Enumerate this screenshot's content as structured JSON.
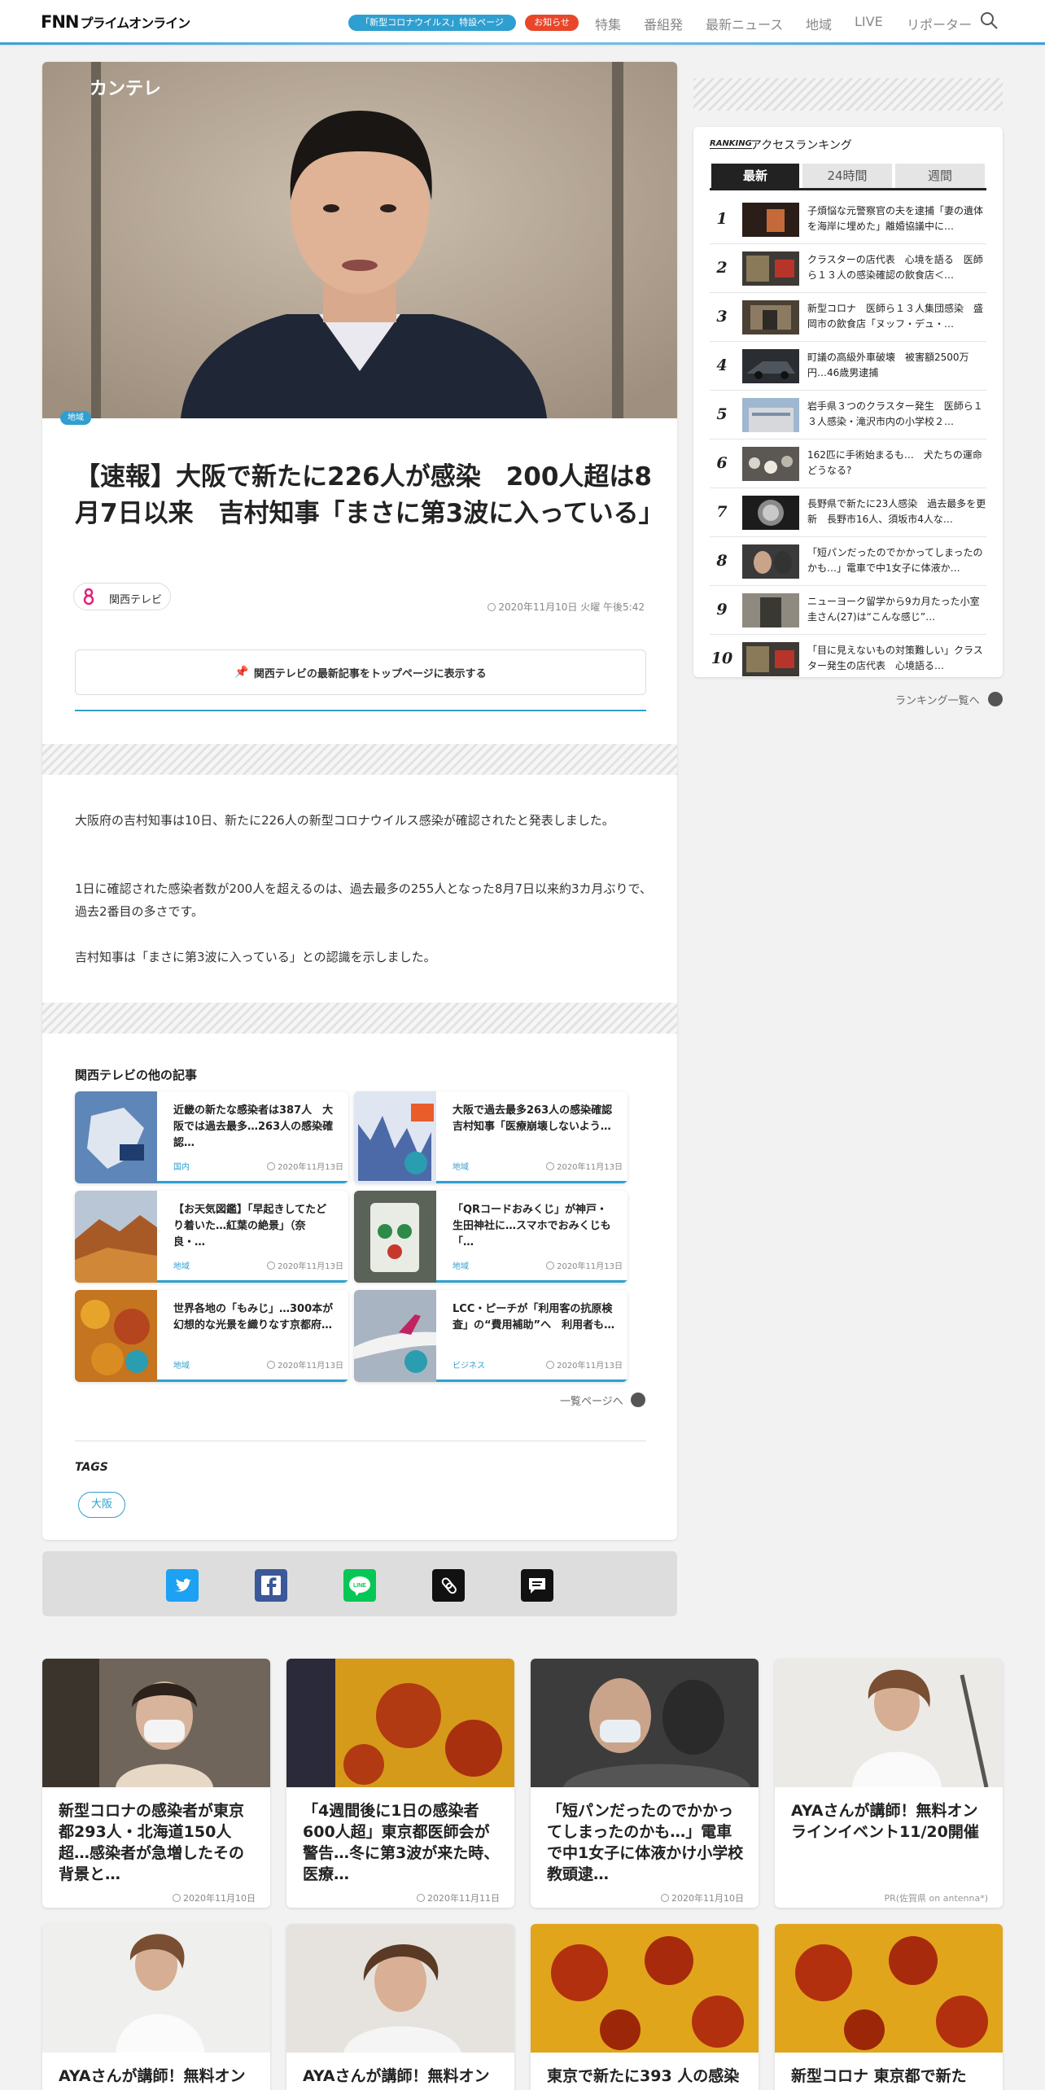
{
  "header": {
    "logo_fnn": "FNN",
    "logo_rest": "プライムオンライン",
    "corona_pill": "「新型コロナウイルス」特設ページ",
    "notice_pill": "お知らせ",
    "nav": [
      "特集",
      "番組発",
      "最新ニュース",
      "地域",
      "LIVE",
      "リポーター"
    ]
  },
  "article": {
    "hero_logo": "カンテレ",
    "category": "地域",
    "title": "【速報】大阪で新たに226人が感染　200人超は8月7日以来　吉村知事「まさに第3波に入っている」",
    "source": "関西テレビ",
    "date": "2020年11月10日 火曜 午後5:42",
    "follow_label": "関西テレビの最新記事をトップページに表示する",
    "paragraphs": [
      "大阪府の吉村知事は10日、新たに226人の新型コロナウイルス感染が確認されたと発表しました。",
      "1日に確認された感染者数が200人を超えるのは、過去最多の255人となった8月7日以来約3カ月ぶりで、過去2番目の多さです。",
      "吉村知事は「まさに第3波に入っている」との認識を示しました。"
    ]
  },
  "related": {
    "section_title": "関西テレビの他の記事",
    "items": [
      {
        "title": "近畿の新たな感染者は387人　大阪では過去最多…263人の感染確認…",
        "cat": "国内",
        "date": "2020年11月13日"
      },
      {
        "title": "大阪で過去最多263人の感染確認　吉村知事「医療崩壊しないよう…",
        "cat": "地域",
        "date": "2020年11月13日"
      },
      {
        "title": "【お天気図鑑】「早起きしてたどり着いた…紅葉の絶景」（奈良・…",
        "cat": "地域",
        "date": "2020年11月13日"
      },
      {
        "title": "「QRコードおみくじ」が神戸・生田神社に…スマホでおみくじも「…",
        "cat": "地域",
        "date": "2020年11月13日"
      },
      {
        "title": "世界各地の「もみじ」…300本が幻想的な光景を織りなす京都府…",
        "cat": "地域",
        "date": "2020年11月13日"
      },
      {
        "title": "LCC・ピーチが「利用客の抗原検査」の“費用補助”へ　利用者も…",
        "cat": "ビジネス",
        "date": "2020年11月13日"
      }
    ],
    "more_label": "一覧ページへ"
  },
  "tags": {
    "label": "TAGS",
    "items": [
      "大阪"
    ]
  },
  "ranking": {
    "head_en": "RANKING",
    "head_jp": "アクセスランキング",
    "tabs": [
      "最新",
      "24時間",
      "週間"
    ],
    "items": [
      {
        "num": "1",
        "title": "子煩悩な元警察官の夫を逮捕「妻の遺体を海岸に埋めた」離婚協議中に…"
      },
      {
        "num": "2",
        "title": "クラスターの店代表　心境を語る　医師ら１３人の感染確認の飲食店＜…"
      },
      {
        "num": "3",
        "title": "新型コロナ　医師ら１３人集団感染　盛岡市の飲食店「ヌッフ・デュ・…"
      },
      {
        "num": "4",
        "title": "町議の高級外車破壊　被害額2500万円…46歳男逮捕"
      },
      {
        "num": "5",
        "title": "岩手県３つのクラスター発生　医師ら１３人感染・滝沢市内の小学校２…"
      },
      {
        "num": "6",
        "title": "162匹に手術始まるも…　犬たちの運命どうなる?"
      },
      {
        "num": "7",
        "title": "長野県で新たに23人感染　過去最多を更新　長野市16人、須坂市4人な…"
      },
      {
        "num": "8",
        "title": "「短パンだったのでかかってしまったのかも…」電車で中1女子に体液か…"
      },
      {
        "num": "9",
        "title": "ニューヨーク留学から9カ月たった小室圭さん(27)は“こんな感じ”…"
      },
      {
        "num": "10",
        "title": "「目に見えないもの対策難しい」クラスター発生の店代表　心境語る…"
      }
    ],
    "more_label": "ランキング一覧へ"
  },
  "bottom": [
    {
      "title": "新型コロナの感染者が東京都293人・北海道150人超…感染者が急増したその背景と…",
      "date": "2020年11月10日"
    },
    {
      "title": "「4週間後に1日の感染者600人超」東京都医師会が警告…冬に第3波が来た時、医療…",
      "date": "2020年11月11日"
    },
    {
      "title": "「短パンだったのでかかってしまったのかも…」電車で中1女子に体液かけ小学校教頭逮…",
      "date": "2020年11月10日"
    },
    {
      "title": "AYAさんが講師！無料オンラインイベント11/20開催",
      "date": "PR(佐賀県 on antenna*)"
    },
    {
      "title": "AYAさんが講師！無料オン",
      "date": ""
    },
    {
      "title": "AYAさんが講師！無料オン",
      "date": ""
    },
    {
      "title": "東京で新たに393 人の感染",
      "date": ""
    },
    {
      "title": "新型コロナ 東京都で新た",
      "date": ""
    }
  ],
  "colors": {
    "accent": "#2f9fd0",
    "notice": "#e8462a"
  }
}
